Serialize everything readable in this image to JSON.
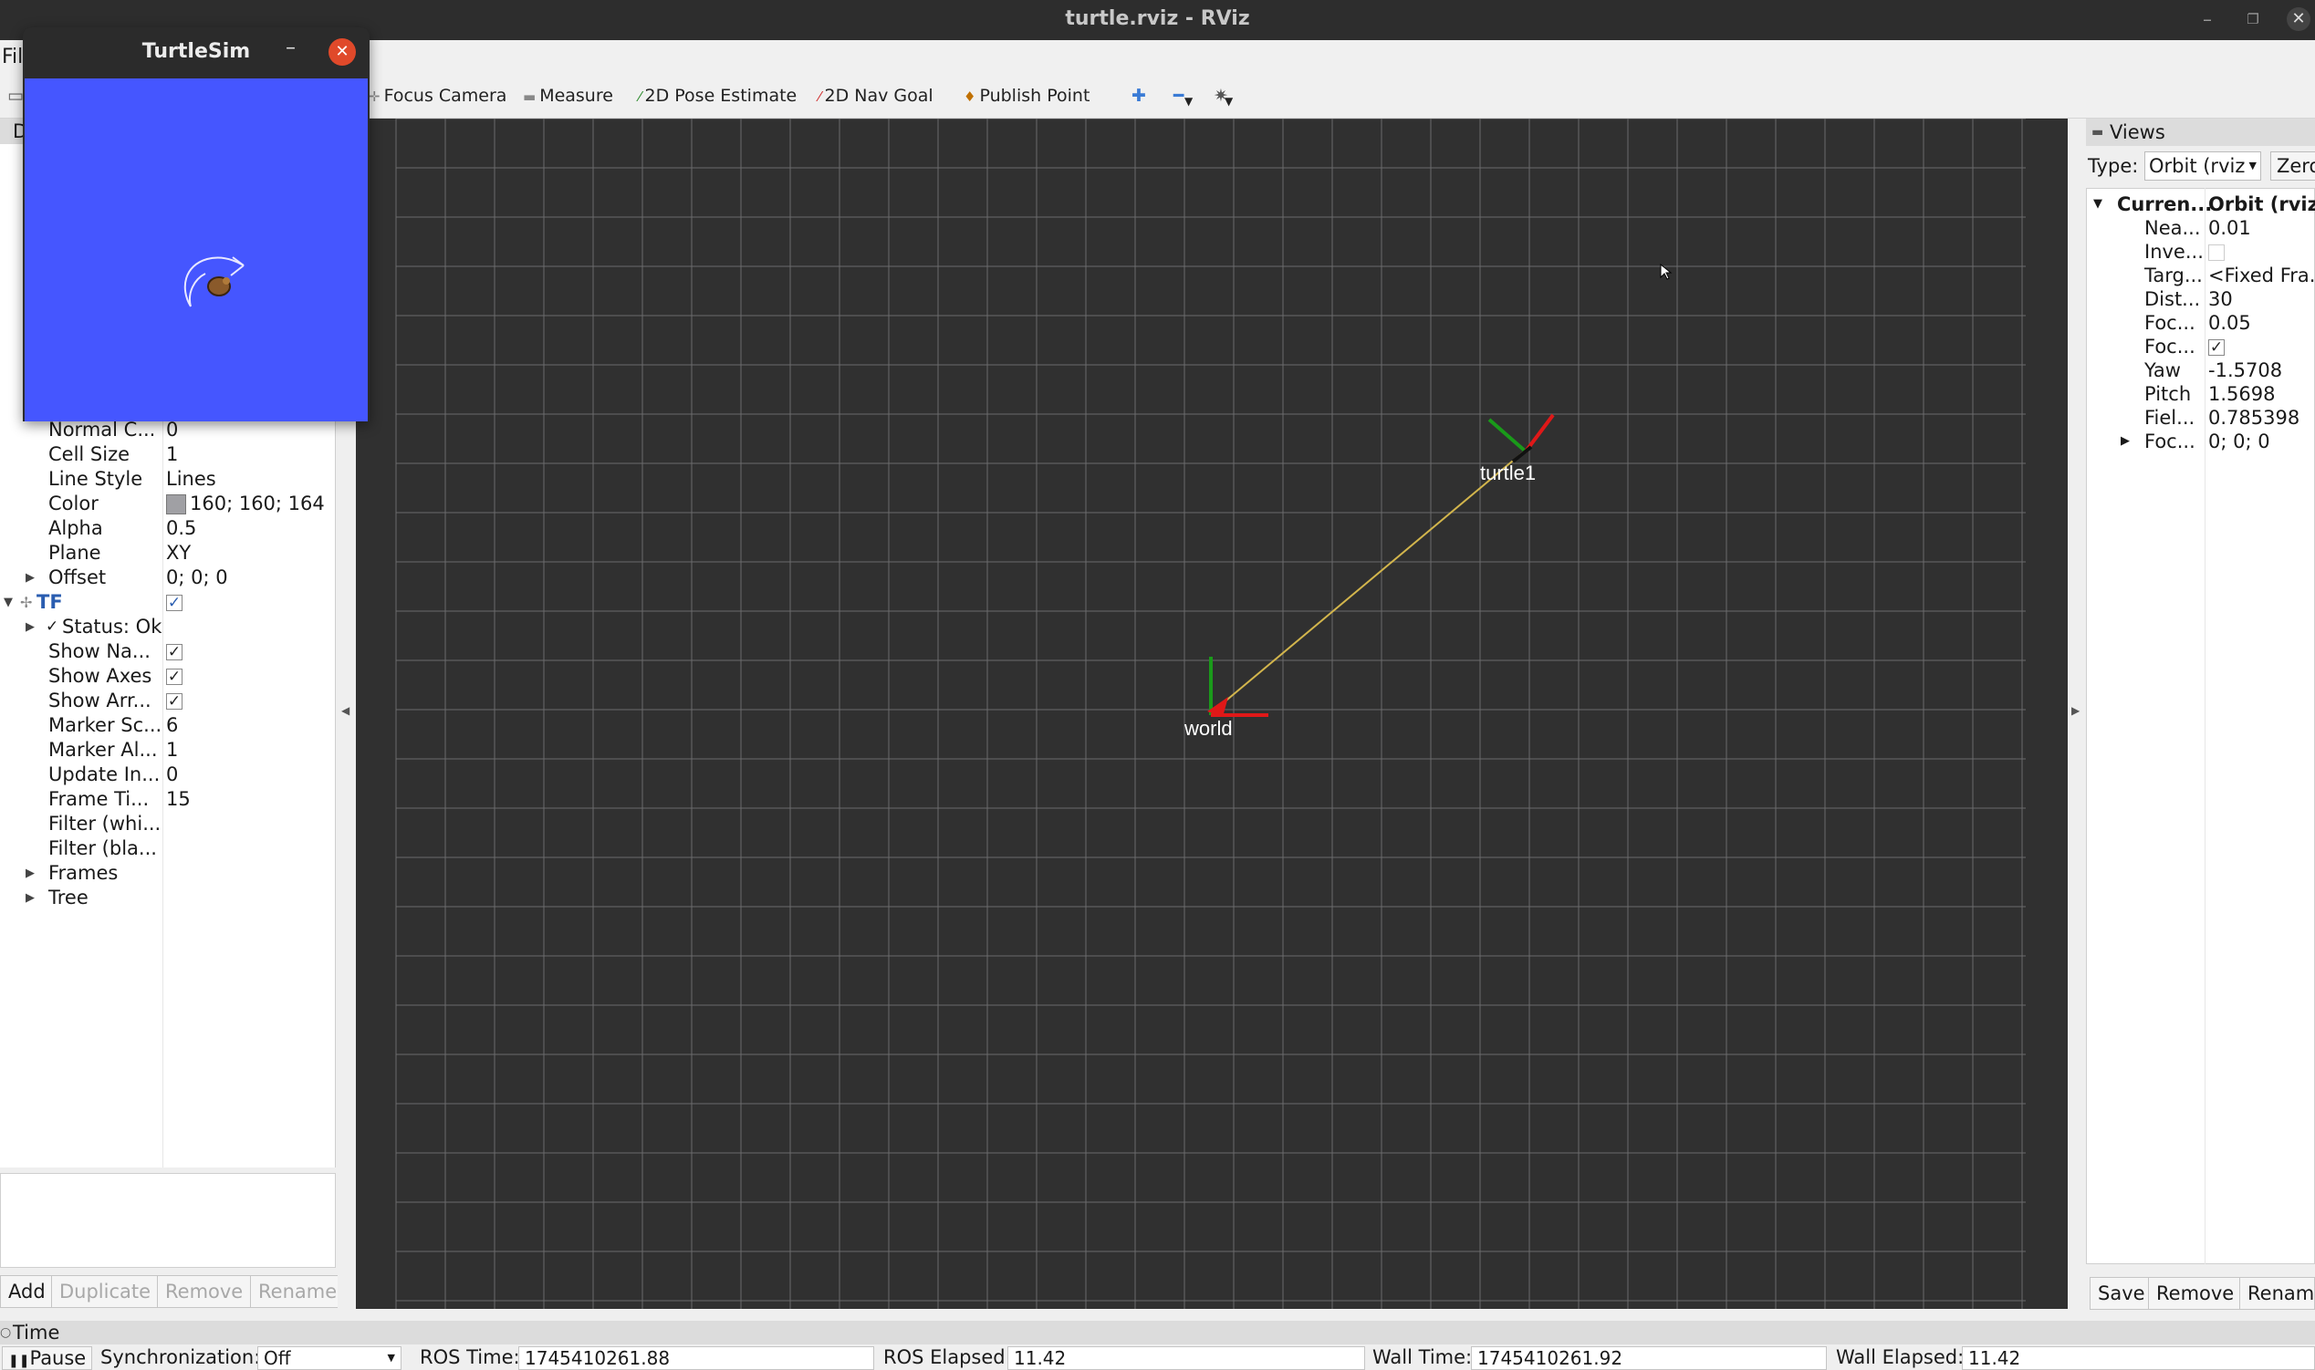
{
  "window": {
    "title": "turtle.rviz - RViz"
  },
  "menubar": {
    "file_label": "Fil"
  },
  "toolbar": {
    "items": [
      "Focus Camera",
      "Measure",
      "2D Pose Estimate",
      "2D Nav Goal",
      "Publish Point"
    ]
  },
  "displays": {
    "header": "D",
    "grid_props": [
      {
        "key": "Normal C...",
        "value": "0"
      },
      {
        "key": "Cell Size",
        "value": "1"
      },
      {
        "key": "Line Style",
        "value": "Lines"
      },
      {
        "key": "Color",
        "value": "160; 160; 164"
      },
      {
        "key": "Alpha",
        "value": "0.5"
      },
      {
        "key": "Plane",
        "value": "XY"
      },
      {
        "key": "Offset",
        "value": "0; 0; 0"
      }
    ],
    "tf_label": "TF",
    "tf_status": "Status: Ok",
    "tf_props": [
      {
        "key": "Show Na...",
        "value": ""
      },
      {
        "key": "Show Axes",
        "value": ""
      },
      {
        "key": "Show Arr...",
        "value": ""
      },
      {
        "key": "Marker Sc...",
        "value": "6"
      },
      {
        "key": "Marker Al...",
        "value": "1"
      },
      {
        "key": "Update In...",
        "value": "0"
      },
      {
        "key": "Frame Ti...",
        "value": "15"
      },
      {
        "key": "Filter (whi...",
        "value": ""
      },
      {
        "key": "Filter (bla...",
        "value": ""
      },
      {
        "key": "Frames",
        "value": ""
      },
      {
        "key": "Tree",
        "value": ""
      }
    ],
    "buttons": {
      "add": "Add",
      "duplicate": "Duplicate",
      "remove": "Remove",
      "rename": "Rename"
    }
  },
  "viewport": {
    "frames": {
      "world": "world",
      "turtle1": "turtle1"
    },
    "grid_color": "#a0a0a4",
    "background": "#303030"
  },
  "views": {
    "header": "Views",
    "type_label": "Type:",
    "type_value": "Orbit (rviz",
    "zero_label": "Zero",
    "current_key": "Curren...",
    "current_value": "Orbit (rviz)",
    "props": [
      {
        "key": "Nea...",
        "value": "0.01"
      },
      {
        "key": "Inve...",
        "value": ""
      },
      {
        "key": "Targ...",
        "value": "<Fixed Fra..."
      },
      {
        "key": "Dist...",
        "value": "30"
      },
      {
        "key": "Foc...",
        "value": "0.05"
      },
      {
        "key": "Foc...",
        "value": ""
      },
      {
        "key": "Yaw",
        "value": "-1.5708"
      },
      {
        "key": "Pitch",
        "value": "1.5698"
      },
      {
        "key": "Fiel...",
        "value": "0.785398"
      },
      {
        "key": "Foc...",
        "value": "0; 0; 0"
      }
    ],
    "buttons": {
      "save": "Save",
      "remove": "Remove",
      "rename": "Rename"
    }
  },
  "time": {
    "header": "Time",
    "pause": "Pause",
    "sync_label": "Synchronization:",
    "sync_value": "Off",
    "ros_time_label": "ROS Time:",
    "ros_time": "1745410261.88",
    "ros_elapsed_label": "ROS Elapsed:",
    "ros_elapsed": "11.42",
    "wall_time_label": "Wall Time:",
    "wall_time": "1745410261.92",
    "wall_elapsed_label": "Wall Elapsed:",
    "wall_elapsed": "11.42"
  },
  "turtlesim": {
    "title": "TurtleSim",
    "background": "#4556ff"
  }
}
